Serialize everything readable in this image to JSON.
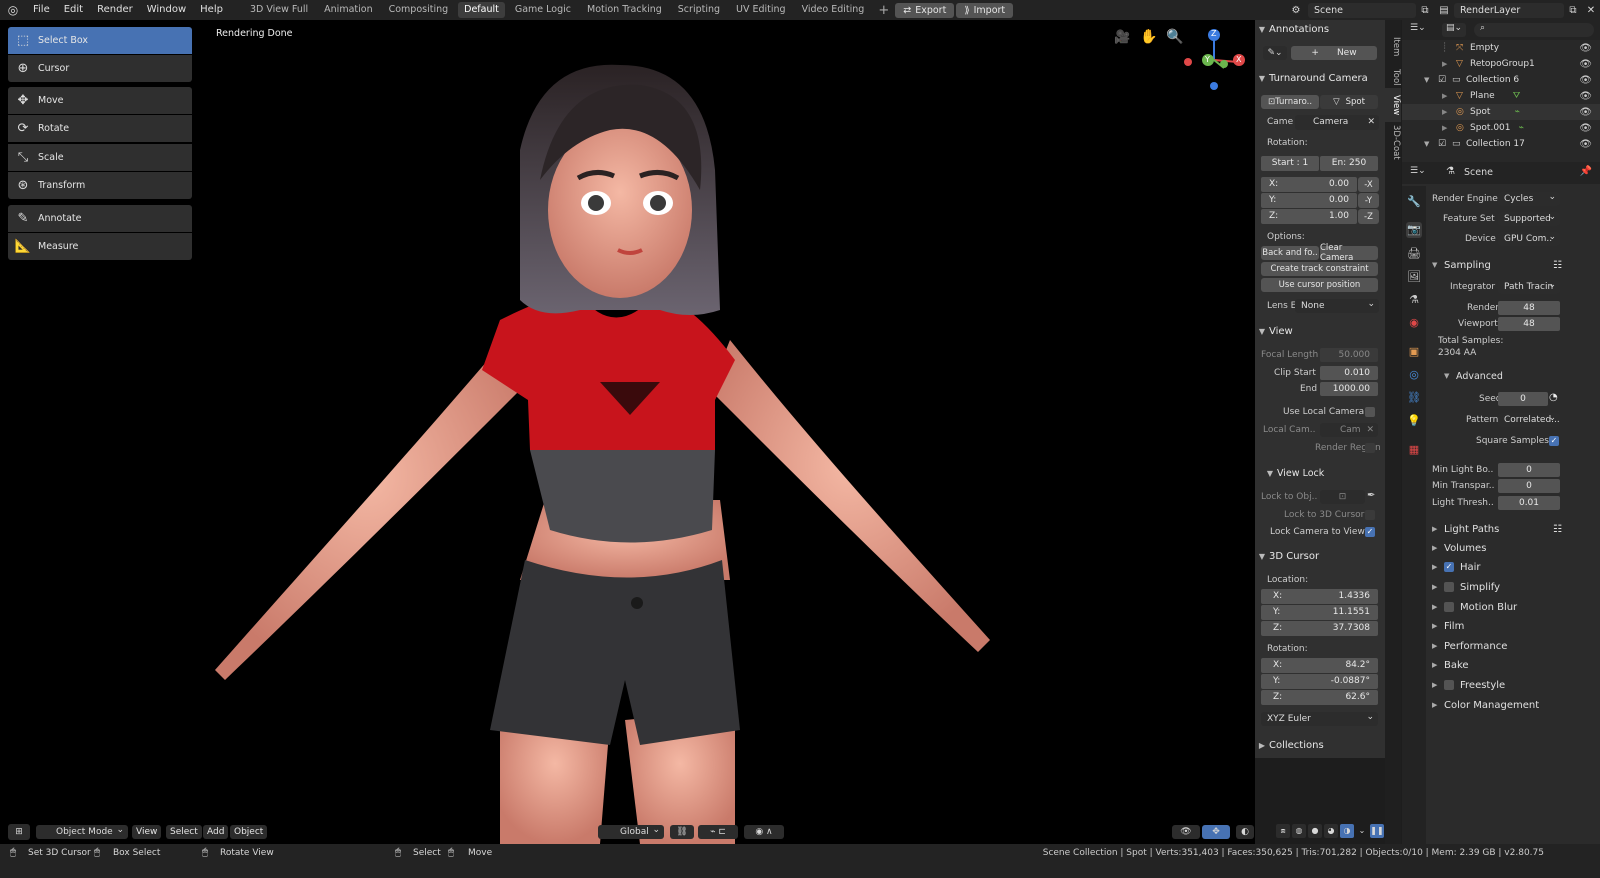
{
  "topbar": {
    "menus": [
      "File",
      "Edit",
      "Render",
      "Window",
      "Help"
    ],
    "workspaces": [
      "3D View Full",
      "Animation",
      "Compositing",
      "Default",
      "Game Logic",
      "Motion Tracking",
      "Scripting",
      "UV Editing",
      "Video Editing"
    ],
    "active_workspace": "Default",
    "export_label": "Export",
    "import_label": "Import",
    "scene_name": "Scene",
    "render_layer": "RenderLayer"
  },
  "viewport": {
    "status_text": "Rendering Done",
    "tools": [
      "Select Box",
      "Cursor",
      "Move",
      "Rotate",
      "Scale",
      "Transform",
      "Annotate",
      "Measure"
    ],
    "active_tool": "Select Box",
    "gizmo_axes": {
      "x": "X",
      "y": "Y",
      "z": "Z"
    },
    "header": {
      "mode": "Object Mode",
      "menus": [
        "View",
        "Select",
        "Add",
        "Object"
      ],
      "orientation": "Global"
    }
  },
  "npanel": {
    "tabs": [
      "Item",
      "Tool",
      "View",
      "3D-Coat"
    ],
    "annotations": {
      "title": "Annotations",
      "new_label": "New"
    },
    "turnaround": {
      "title": "Turnaround Camera",
      "btn1": "Turnaro..",
      "btn2": "Spot",
      "camera_label": "Came",
      "camera_value": "Camera",
      "rotation_label": "Rotation:",
      "start": "Start : 1",
      "end": "En:  250",
      "x_label": "X:",
      "x_value": "0.00",
      "x_btn": "-X",
      "y_label": "Y:",
      "y_value": "0.00",
      "y_btn": "-Y",
      "z_label": "Z:",
      "z_value": "1.00",
      "z_btn": "-Z",
      "options_label": "Options:",
      "back_forth": "Back and fo..",
      "clear_camera": "Clear Camera",
      "create_track": "Create track constraint",
      "use_cursor": "Use cursor position",
      "lens_label": "Lens E",
      "lens_value": "None"
    },
    "view": {
      "title": "View",
      "focal_label": "Focal Length",
      "focal_value": "50.000",
      "clip_start_label": "Clip Start",
      "clip_start_value": "0.010",
      "end_label": "End",
      "end_value": "1000.00",
      "use_local_camera": "Use Local Camera",
      "local_cam_label": "Local Cam..",
      "local_cam_value": "Cam",
      "render_region": "Render Region",
      "view_lock_title": "View Lock",
      "lock_to_obj": "Lock to Obj..",
      "lock_to_cursor": "Lock to 3D Cursor",
      "lock_camera": "Lock Camera to View"
    },
    "cursor": {
      "title": "3D Cursor",
      "location_label": "Location:",
      "loc": [
        {
          "axis": "X:",
          "value": "1.4336"
        },
        {
          "axis": "Y:",
          "value": "11.1551"
        },
        {
          "axis": "Z:",
          "value": "37.7308"
        }
      ],
      "rotation_label": "Rotation:",
      "rot": [
        {
          "axis": "X:",
          "value": "84.2°"
        },
        {
          "axis": "Y:",
          "value": "-0.0887°"
        },
        {
          "axis": "Z:",
          "value": "62.6°"
        }
      ],
      "rot_mode": "XYZ Euler"
    },
    "collections_title": "Collections"
  },
  "outliner": {
    "rows": [
      {
        "name": "Empty",
        "icon": "empty-icon",
        "indent": 3
      },
      {
        "name": "RetopoGroup1",
        "icon": "mesh-icon",
        "indent": 3
      },
      {
        "name": "Collection 6",
        "icon": "collection-icon",
        "indent": 1
      },
      {
        "name": "Plane",
        "icon": "mesh-icon",
        "indent": 3
      },
      {
        "name": "Spot",
        "icon": "light-icon",
        "indent": 3
      },
      {
        "name": "Spot.001",
        "icon": "light-icon",
        "indent": 3
      },
      {
        "name": "Collection 17",
        "icon": "collection-icon",
        "indent": 1
      }
    ]
  },
  "props": {
    "context": "Scene",
    "render_engine_label": "Render Engine",
    "render_engine": "Cycles",
    "feature_set_label": "Feature Set",
    "feature_set": "Supported",
    "device_label": "Device",
    "device": "GPU Com..",
    "sampling_title": "Sampling",
    "integrator_label": "Integrator",
    "integrator": "Path Tracin",
    "render_label": "Render",
    "render_value": "48",
    "viewport_label": "Viewport",
    "viewport_value": "48",
    "total_samples_label": "Total Samples:",
    "total_samples_value": "2304 AA",
    "advanced_title": "Advanced",
    "seed_label": "Seed",
    "seed_value": "0",
    "pattern_label": "Pattern",
    "pattern_value": "Correlated...",
    "square_samples": "Square Samples",
    "min_light_bounces_label": "Min Light Bo..",
    "min_light_bounces": "0",
    "min_transparent_label": "Min Transpar..",
    "min_transparent": "0",
    "light_threshold_label": "Light Thresh..",
    "light_threshold": "0.01",
    "sections": [
      "Light Paths",
      "Volumes",
      "Hair",
      "Simplify",
      "Motion Blur",
      "Film",
      "Performance",
      "Bake",
      "Freestyle",
      "Color Management"
    ]
  },
  "statusbar": {
    "left": [
      "Set 3D Cursor",
      "Box Select",
      "Rotate View",
      "Select",
      "Move"
    ],
    "right": "Scene Collection | Spot | Verts:351,403 | Faces:350,625 | Tris:701,282 | Objects:0/10 | Mem: 2.39 GB | v2.80.75"
  },
  "colors": {
    "accent": "#4772b3",
    "header": "#232323",
    "panel": "#303030",
    "viewport": "#000000",
    "shirt": "#c8141c"
  }
}
